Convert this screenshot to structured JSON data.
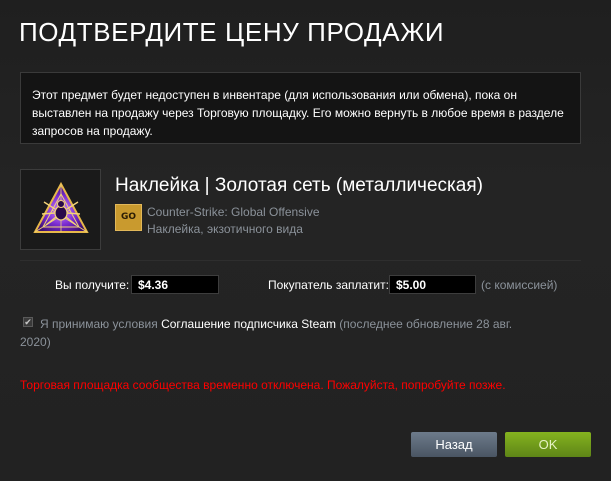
{
  "dialog": {
    "title": "ПОДТВЕРДИТЕ ЦЕНУ ПРОДАЖИ",
    "notice": "Этот предмет будет недоступен в инвентаре (для использования или обмена), пока он выставлен на продажу через Торговую площадку. Его можно вернуть в любое время в разделе запросов на продажу."
  },
  "item": {
    "name": "Наклейка | Золотая сеть (металлическая)",
    "game": "Counter-Strike: Global Offensive",
    "game_icon_text": "GO",
    "game_icon": "csgo-icon",
    "type": "Наклейка, экзотичного вида",
    "image_icon": "spider-web-sticker-icon"
  },
  "pricing": {
    "receive_label": "Вы получите:",
    "receive_value": "$4.36",
    "buyer_label": "Покупатель заплатит:",
    "buyer_value": "$5.00",
    "fee_note": "(с комиссией)"
  },
  "agreement": {
    "checked": true,
    "prefix": "Я принимаю условия ",
    "link": "Соглашение подписчика Steam",
    "suffix": " (последнее обновление 28 авг. 2020)"
  },
  "error": "Торговая площадка сообщества временно отключена. Пожалуйста, попробуйте позже.",
  "buttons": {
    "back": "Назад",
    "ok": "OK"
  },
  "colors": {
    "background": "#222222",
    "error": "#ff0000",
    "ok_button": "#71a01b",
    "back_button": "#5c6877"
  }
}
